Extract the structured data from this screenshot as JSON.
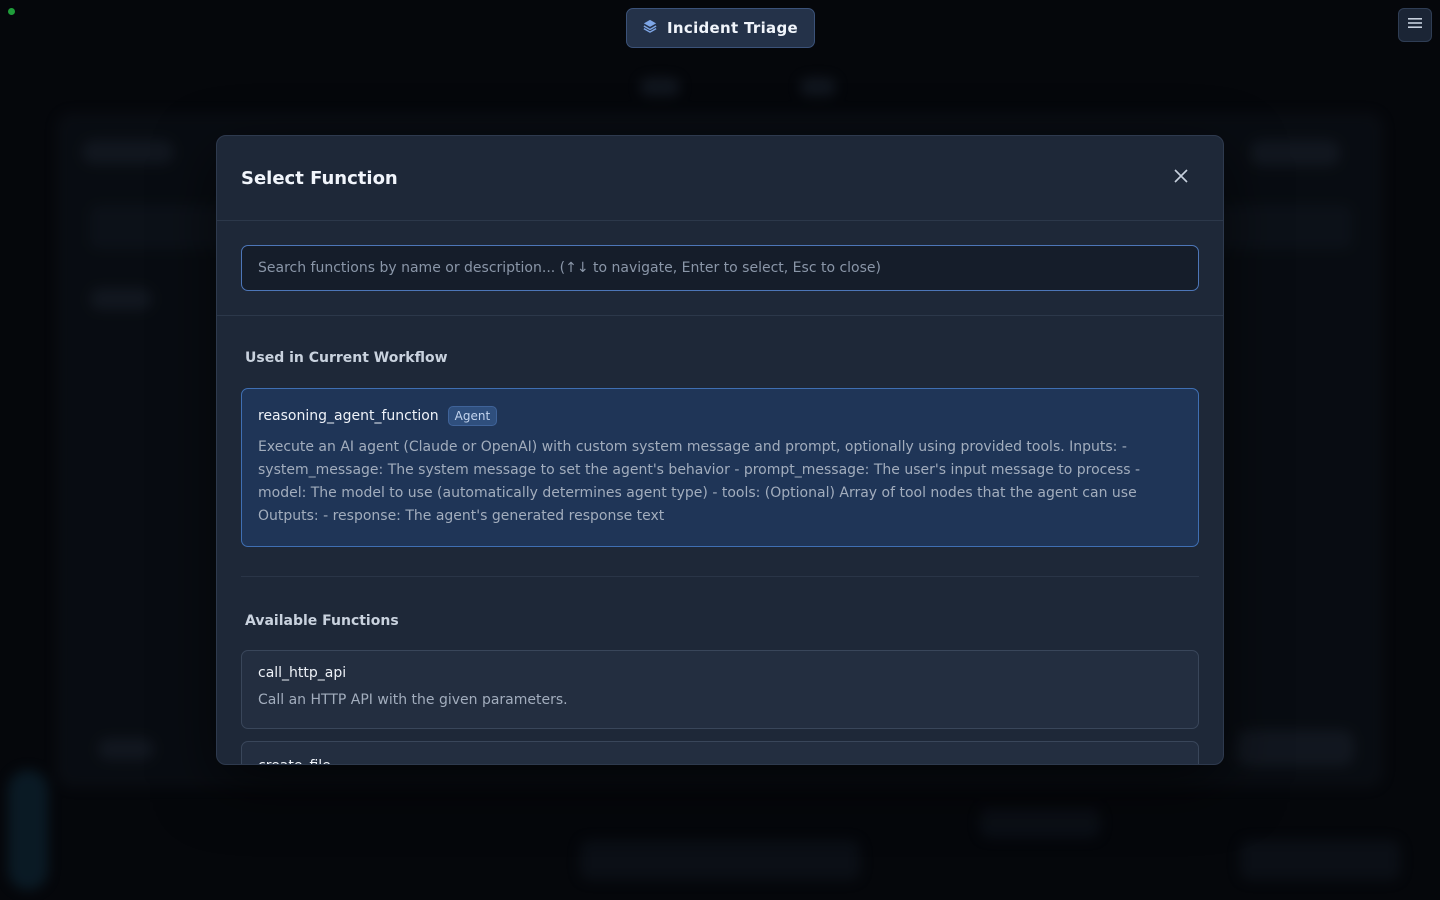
{
  "workflow": {
    "title": "Incident Triage"
  },
  "modal": {
    "title": "Select Function",
    "search_placeholder": "Search functions by name or description... (↑↓ to navigate, Enter to select, Esc to close)",
    "sections": {
      "used": {
        "title": "Used in Current Workflow",
        "items": [
          {
            "name": "reasoning_agent_function",
            "badge": "Agent",
            "description": "Execute an AI agent (Claude or OpenAI) with custom system message and prompt, optionally using provided tools. Inputs: - system_message: The system message to set the agent's behavior - prompt_message: The user's input message to process - model: The model to use (automatically determines agent type) - tools: (Optional) Array of tool nodes that the agent can use Outputs: - response: The agent's generated response text"
          }
        ]
      },
      "available": {
        "title": "Available Functions",
        "items": [
          {
            "name": "call_http_api",
            "description": "Call an HTTP API with the given parameters."
          },
          {
            "name": "create_file",
            "description": ""
          }
        ]
      }
    }
  },
  "colors": {
    "accent": "#4d76b8",
    "selected_bg": "#1f3557",
    "modal_bg": "#1e2838",
    "status_ok": "#1f9d3a"
  },
  "icons": {
    "workflow": "layers-icon",
    "menu": "hamburger-icon",
    "close": "close-icon"
  }
}
